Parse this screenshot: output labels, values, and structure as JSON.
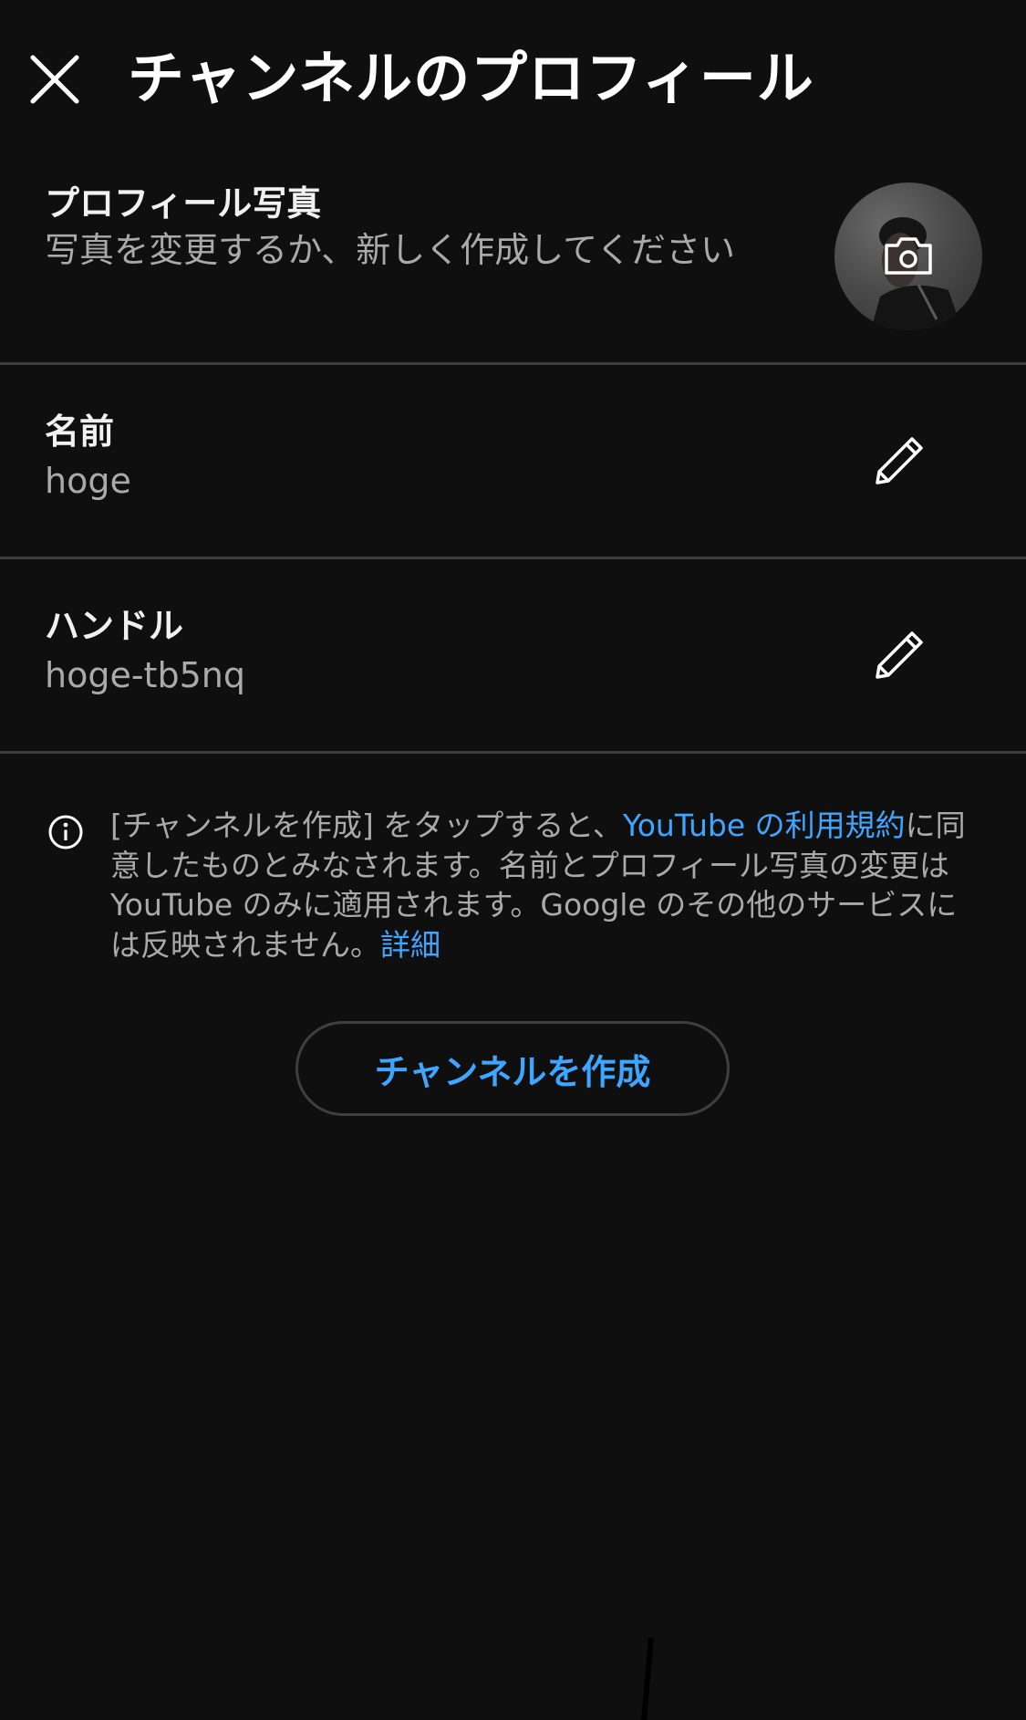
{
  "header": {
    "title": "チャンネルのプロフィール"
  },
  "photo_row": {
    "label": "プロフィール写真",
    "description": "写真を変更するか、新しく作成してください"
  },
  "name_row": {
    "label": "名前",
    "value": "hoge"
  },
  "handle_row": {
    "label": "ハンドル",
    "value": "hoge-tb5nq"
  },
  "info": {
    "text_before_link": "[チャンネルを作成] をタップすると、",
    "terms_link": "YouTube の利用規約",
    "text_after_link": "に同意したものとみなされます。名前とプロフィール写真の変更は YouTube のみに適用されます。Google のその他のサービスには反映されません。",
    "details_link": "詳細"
  },
  "create_button": {
    "label": "チャンネルを作成"
  },
  "colors": {
    "background": "#0f0f0f",
    "accent": "#3ea6ff",
    "divider": "#3d3d3d",
    "secondary_text": "#aaaaaa"
  }
}
